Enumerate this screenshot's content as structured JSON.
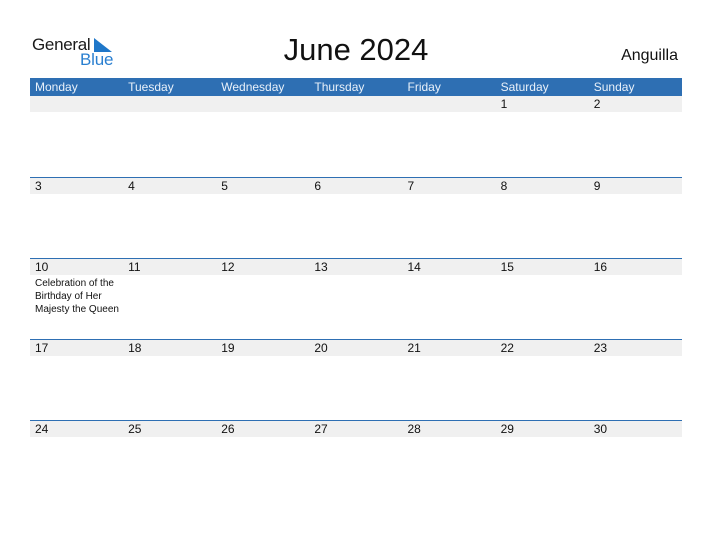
{
  "logo": {
    "general": "General",
    "blue": "Blue"
  },
  "title": "June 2024",
  "country": "Anguilla",
  "colors": {
    "header_bg": "#2e6fb3",
    "date_row_bg": "#f0f0f0",
    "logo_blue": "#2a7fd0"
  },
  "weekdays": [
    "Monday",
    "Tuesday",
    "Wednesday",
    "Thursday",
    "Friday",
    "Saturday",
    "Sunday"
  ],
  "weeks": [
    {
      "days": [
        "",
        "",
        "",
        "",
        "",
        "1",
        "2"
      ],
      "events": [
        "",
        "",
        "",
        "",
        "",
        "",
        ""
      ]
    },
    {
      "days": [
        "3",
        "4",
        "5",
        "6",
        "7",
        "8",
        "9"
      ],
      "events": [
        "",
        "",
        "",
        "",
        "",
        "",
        ""
      ]
    },
    {
      "days": [
        "10",
        "11",
        "12",
        "13",
        "14",
        "15",
        "16"
      ],
      "events": [
        "Celebration of the Birthday of Her Majesty the Queen",
        "",
        "",
        "",
        "",
        "",
        ""
      ]
    },
    {
      "days": [
        "17",
        "18",
        "19",
        "20",
        "21",
        "22",
        "23"
      ],
      "events": [
        "",
        "",
        "",
        "",
        "",
        "",
        ""
      ]
    },
    {
      "days": [
        "24",
        "25",
        "26",
        "27",
        "28",
        "29",
        "30"
      ],
      "events": [
        "",
        "",
        "",
        "",
        "",
        "",
        ""
      ]
    }
  ]
}
